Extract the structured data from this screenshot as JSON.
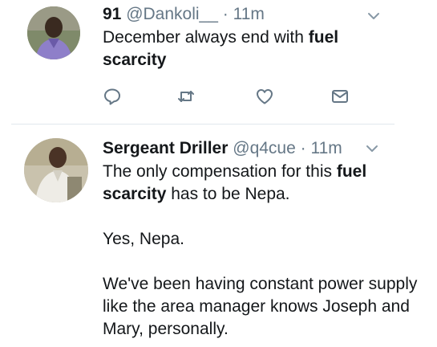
{
  "tweets": [
    {
      "display_name": "91",
      "handle": "@Dankoli__",
      "separator": "·",
      "time": "11m",
      "text_segments": [
        {
          "text": "December always end with ",
          "bold": false
        },
        {
          "text": "fuel",
          "bold": true
        },
        {
          "text": " ",
          "bold": false
        },
        {
          "text": "scarcity",
          "bold": true
        }
      ],
      "actions": [
        "reply-icon",
        "retweet-icon",
        "like-icon",
        "direct-message-icon"
      ]
    },
    {
      "display_name": "Sergeant Driller",
      "handle": "@q4cue",
      "separator": "·",
      "time": "11m",
      "paragraphs": [
        [
          {
            "text": "The only compensation for this ",
            "bold": false
          },
          {
            "text": "fuel",
            "bold": true
          },
          {
            "text": " ",
            "bold": false
          },
          {
            "text": "scarcity",
            "bold": true
          },
          {
            "text": " has to be Nepa.",
            "bold": false
          }
        ],
        [
          {
            "text": "Yes, Nepa.",
            "bold": false
          }
        ],
        [
          {
            "text": "We've been having constant power supply like the area manager knows Joseph and Mary, personally.",
            "bold": false
          }
        ]
      ]
    }
  ],
  "colors": {
    "text": "#14171a",
    "secondary": "#657786",
    "icon": "#657786",
    "divider": "#e1e8ed"
  }
}
